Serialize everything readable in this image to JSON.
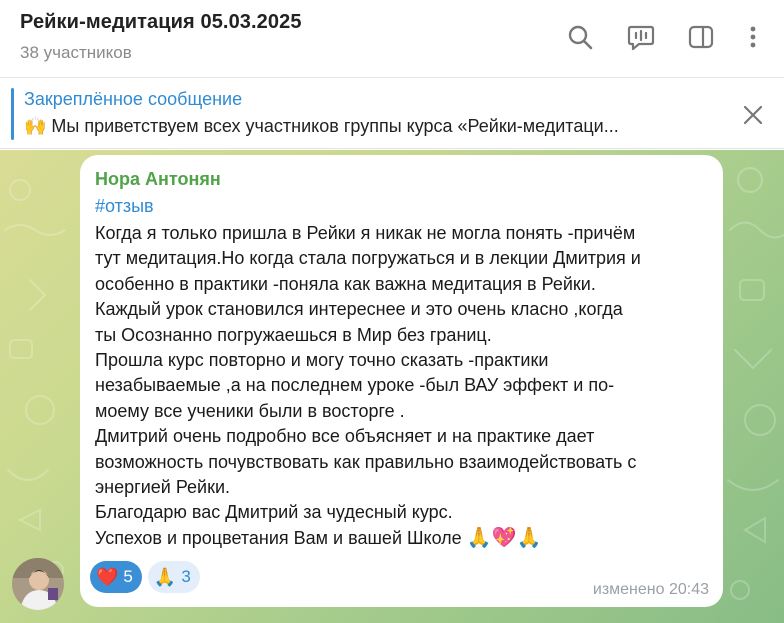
{
  "header": {
    "title": "Рейки-медитация 05.03.2025",
    "subtitle": "38 участников",
    "icons": [
      "search-icon",
      "video-chat-icon",
      "sidebar-toggle-icon",
      "more-vertical-icon"
    ]
  },
  "pinned": {
    "title": "Закреплённое сообщение",
    "text": "🙌 Мы приветствуем всех участников группы курса «Рейки-медитаци..."
  },
  "message": {
    "author": "Нора Антонян",
    "author_color": "#51a34a",
    "hashtag": "#отзыв",
    "lines": [
      "Когда я только пришла в Рейки я никак не могла понять -причём",
      "тут медитация.Но когда стала погружаться и в лекции Дмитрия и",
      "особенно в практики -поняла как  важна медитация в Рейки.",
      "Каждый урок становился интереснее и это очень класно ,когда",
      "ты Осознанно погружаешься в Мир без границ.",
      "Прошла курс повторно и могу точно сказать -практики",
      "незабываемые ,а на последнем уроке -был ВАУ эффект и по-",
      "моему все ученики были в восторге .",
      "Дмитрий очень подробно все объясняет и на практике дает",
      "возможность почувствовать как правильно взаимодействовать с",
      "энергией Рейки.",
      "Благодарю вас Дмитрий за чудесный курс."
    ],
    "last_line": "Успехов и процветания Вам и вашей Школе",
    "last_line_emoji": "🙏💖🙏",
    "reactions": [
      {
        "emoji": "❤️",
        "count": "5",
        "selected": true
      },
      {
        "emoji": "🙏",
        "count": "3",
        "selected": false
      }
    ],
    "edited": "изменено 20:43"
  },
  "colors": {
    "accent": "#2f8bd3",
    "chat_bg_start": "#d9dc95",
    "chat_bg_end": "#88bd86"
  }
}
